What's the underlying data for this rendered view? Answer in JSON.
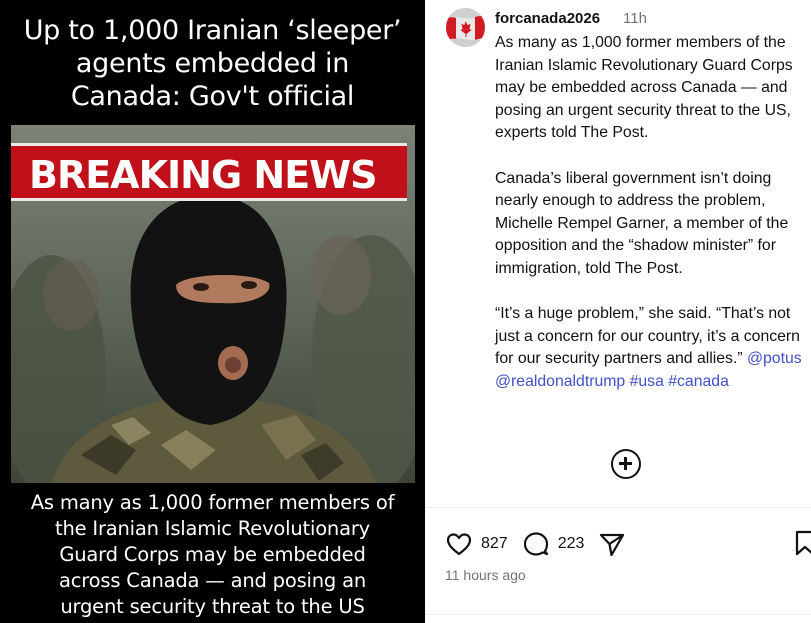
{
  "media": {
    "headline_lines": [
      "Up to 1,000 Iranian ‘sleeper’",
      "agents embedded in",
      "Canada: Gov't official"
    ],
    "banner": "BREAKING NEWS",
    "caption_lines": [
      "As many as 1,000 former members of",
      "the Iranian Islamic Revolutionary",
      "Guard Corps may be embedded",
      "across Canada — and posing an",
      "urgent security threat to the US"
    ]
  },
  "post": {
    "username": "forcanada2026",
    "time_short": "11h",
    "paragraphs": [
      "As many as 1,000 former members of the Iranian Islamic Revolutionary Guard Corps may be embedded across Canada — and posing an urgent security threat to the US, experts told The Post.",
      "Canada’s liberal government isn’t doing nearly enough to address the problem, Michelle Rempel Garner, a member of the opposition and the “shadow minister” for immigration, told The Post.",
      "“It’s a huge problem,” she said. “That’s not just a concern for our country, it’s a concern for our security partners and allies.”"
    ],
    "tags": [
      "@potus",
      "@realdonaldtrump",
      "#usa",
      "#canada"
    ],
    "likes": "827",
    "comments": "223",
    "time_ago": "11 hours ago"
  },
  "icons": {
    "avatar": "canada-flag-avatar",
    "like": "heart-icon",
    "comment": "comment-icon",
    "share": "share-icon",
    "save": "bookmark-icon",
    "add_comment": "plus-circle-icon"
  },
  "colors": {
    "banner_red": "#c0101a",
    "link_blue": "#4150c8",
    "muted_text": "#737373"
  }
}
